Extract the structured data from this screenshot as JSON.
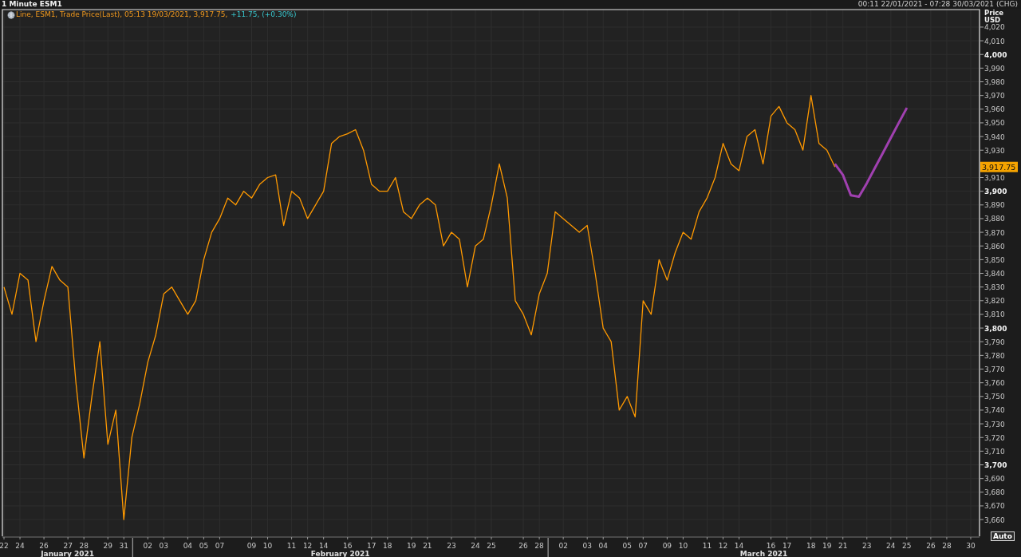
{
  "window": {
    "title": "1 Minute ESM1",
    "range": "00:11 22/01/2021 - 07:28 30/03/2021 (CHG)"
  },
  "legend": {
    "text": "Line, ESM1, Trade Price(Last), 05:13 19/03/2021, 3,917.75, ",
    "change": "+11.75, (+0.30%)"
  },
  "price_axis": {
    "title": "Price",
    "currency": "USD",
    "button": "Auto"
  },
  "x_axis": {
    "months": [
      "January 2021",
      "February 2021",
      "March 2021"
    ]
  },
  "chart_data": {
    "type": "line",
    "categories": [
      "22",
      null,
      "24",
      null,
      null,
      "26",
      null,
      null,
      "27",
      null,
      "28",
      null,
      null,
      "29",
      null,
      "31",
      null,
      null,
      "02",
      null,
      "03",
      null,
      null,
      "04",
      null,
      "05",
      null,
      "07",
      null,
      null,
      null,
      "09",
      null,
      "10",
      null,
      null,
      "11",
      null,
      "12",
      null,
      "14",
      null,
      null,
      "16",
      null,
      null,
      "17",
      null,
      "18",
      null,
      null,
      "19",
      null,
      "21",
      null,
      null,
      "23",
      null,
      null,
      "24",
      null,
      "25",
      null,
      null,
      null,
      "26",
      null,
      "28",
      null,
      null,
      "02",
      null,
      null,
      "03",
      null,
      "04",
      null,
      null,
      "05",
      null,
      "07",
      null,
      null,
      "09",
      null,
      "10",
      null,
      null,
      "11",
      null,
      "12",
      null,
      "14",
      null,
      null,
      null,
      "16",
      null,
      "17",
      null,
      null,
      "18",
      null,
      "19",
      null,
      "21",
      null,
      null,
      "23",
      null,
      null,
      "24",
      null,
      "25",
      null,
      null,
      "26",
      null,
      "28",
      null,
      null,
      "30",
      null
    ],
    "series": [
      {
        "color": "#ff9900",
        "values": [
          3830,
          3810,
          3840,
          3835,
          3790,
          3820,
          3845,
          3835,
          3830,
          3760,
          3705,
          3750,
          3790,
          3715,
          3740,
          3660,
          3720,
          3745,
          3775,
          3795,
          3825,
          3830,
          3820,
          3810,
          3820,
          3850,
          3870,
          3880,
          3895,
          3890,
          3900,
          3895,
          3905,
          3910,
          3912,
          3875,
          3900,
          3895,
          3880,
          3890,
          3900,
          3935,
          3940,
          3942,
          3945,
          3930,
          3905,
          3900,
          3900,
          3910,
          3885,
          3880,
          3890,
          3895,
          3890,
          3860,
          3870,
          3865,
          3830,
          3860,
          3865,
          3890,
          3920,
          3895,
          3820,
          3810,
          3795,
          3825,
          3840,
          3885,
          3880,
          3875,
          3870,
          3875,
          3840,
          3800,
          3790,
          3740,
          3750,
          3735,
          3820,
          3810,
          3850,
          3835,
          3855,
          3870,
          3865,
          3885,
          3895,
          3910,
          3935,
          3920,
          3915,
          3940,
          3945,
          3920,
          3955,
          3962,
          3950,
          3945,
          3930,
          3970,
          3935,
          3930,
          3917.75,
          null,
          null,
          null,
          null,
          null,
          null,
          null,
          null,
          null,
          null,
          null,
          null,
          null,
          null,
          null,
          null,
          null,
          null
        ]
      },
      {
        "color": "#a040b0",
        "values": [
          null,
          null,
          null,
          null,
          null,
          null,
          null,
          null,
          null,
          null,
          null,
          null,
          null,
          null,
          null,
          null,
          null,
          null,
          null,
          null,
          null,
          null,
          null,
          null,
          null,
          null,
          null,
          null,
          null,
          null,
          null,
          null,
          null,
          null,
          null,
          null,
          null,
          null,
          null,
          null,
          null,
          null,
          null,
          null,
          null,
          null,
          null,
          null,
          null,
          null,
          null,
          null,
          null,
          null,
          null,
          null,
          null,
          null,
          null,
          null,
          null,
          null,
          null,
          null,
          null,
          null,
          null,
          null,
          null,
          null,
          null,
          null,
          null,
          null,
          null,
          null,
          null,
          null,
          null,
          null,
          null,
          null,
          null,
          null,
          null,
          null,
          null,
          null,
          null,
          null,
          null,
          null,
          null,
          null,
          null,
          null,
          null,
          null,
          null,
          null,
          null,
          null,
          null,
          null,
          3920,
          3912,
          3897,
          3896,
          3906,
          3917,
          3928,
          3939,
          3950,
          3961,
          null,
          null,
          null,
          null,
          null,
          null,
          null,
          null,
          null
        ]
      }
    ],
    "ylim": [
      3647.8,
      4032.8
    ],
    "yticks": [
      {
        "value": 3660,
        "label": "3,660"
      },
      {
        "value": 3670,
        "label": "3,670"
      },
      {
        "value": 3680,
        "label": "3,680"
      },
      {
        "value": 3690,
        "label": "3,690"
      },
      {
        "value": 3700,
        "label": "3,700"
      },
      {
        "value": 3710,
        "label": "3,710"
      },
      {
        "value": 3720,
        "label": "3,720"
      },
      {
        "value": 3730,
        "label": "3,730"
      },
      {
        "value": 3740,
        "label": "3,740"
      },
      {
        "value": 3750,
        "label": "3,750"
      },
      {
        "value": 3760,
        "label": "3,760"
      },
      {
        "value": 3770,
        "label": "3,770"
      },
      {
        "value": 3780,
        "label": "3,780"
      },
      {
        "value": 3790,
        "label": "3,790"
      },
      {
        "value": 3800,
        "label": "3,800"
      },
      {
        "value": 3810,
        "label": "3,810"
      },
      {
        "value": 3820,
        "label": "3,820"
      },
      {
        "value": 3830,
        "label": "3,830"
      },
      {
        "value": 3840,
        "label": "3,840"
      },
      {
        "value": 3850,
        "label": "3,850"
      },
      {
        "value": 3860,
        "label": "3,860"
      },
      {
        "value": 3870,
        "label": "3,870"
      },
      {
        "value": 3880,
        "label": "3,880"
      },
      {
        "value": 3890,
        "label": "3,890"
      },
      {
        "value": 3900,
        "label": "3,900"
      },
      {
        "value": 3910,
        "label": "3,910"
      },
      {
        "value": 3930,
        "label": "3,930"
      },
      {
        "value": 3940,
        "label": "3,940"
      },
      {
        "value": 3950,
        "label": "3,950"
      },
      {
        "value": 3960,
        "label": "3,960"
      },
      {
        "value": 3970,
        "label": "3,970"
      },
      {
        "value": 3980,
        "label": "3,980"
      },
      {
        "value": 3990,
        "label": "3,990"
      },
      {
        "value": 4000,
        "label": "4,000"
      },
      {
        "value": 4010,
        "label": "4,010"
      },
      {
        "value": 4020,
        "label": "4,020"
      }
    ],
    "grid": true,
    "annotations": [
      "3,917.75"
    ]
  }
}
